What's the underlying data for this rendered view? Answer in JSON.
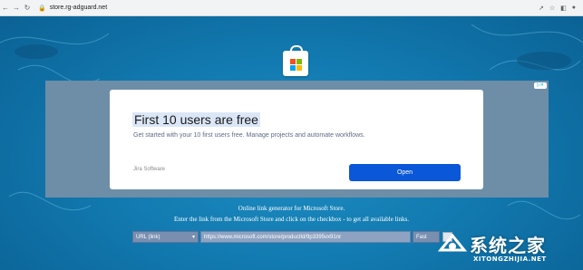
{
  "browser": {
    "url": "store.rg-adguard.net"
  },
  "ad": {
    "adchoices_label": "",
    "title": "First 10 users are free",
    "description": "Get started with your 10 first users free. Manage projects and automate workflows.",
    "brand": "Jira Software",
    "cta_label": "Open"
  },
  "info": {
    "line1": "Online link generator for Microsoft Store.",
    "line2": "Enter the link from the Microsoft Store and click on the checkbox - to get all available links."
  },
  "form": {
    "type_select_value": "URL (link)",
    "url_value": "https://www.microsoft.com/store/productId/9p3395vx91nr",
    "ring_select_value": "Fast"
  },
  "watermark": {
    "title": "系统之家",
    "subtitle": "XITONGZHIJIA.NET"
  },
  "colors": {
    "background": "#127ab0",
    "cta": "#0a57d8",
    "ms_red": "#f25022",
    "ms_green": "#7fba00",
    "ms_blue": "#00a4ef",
    "ms_yellow": "#ffb900"
  }
}
